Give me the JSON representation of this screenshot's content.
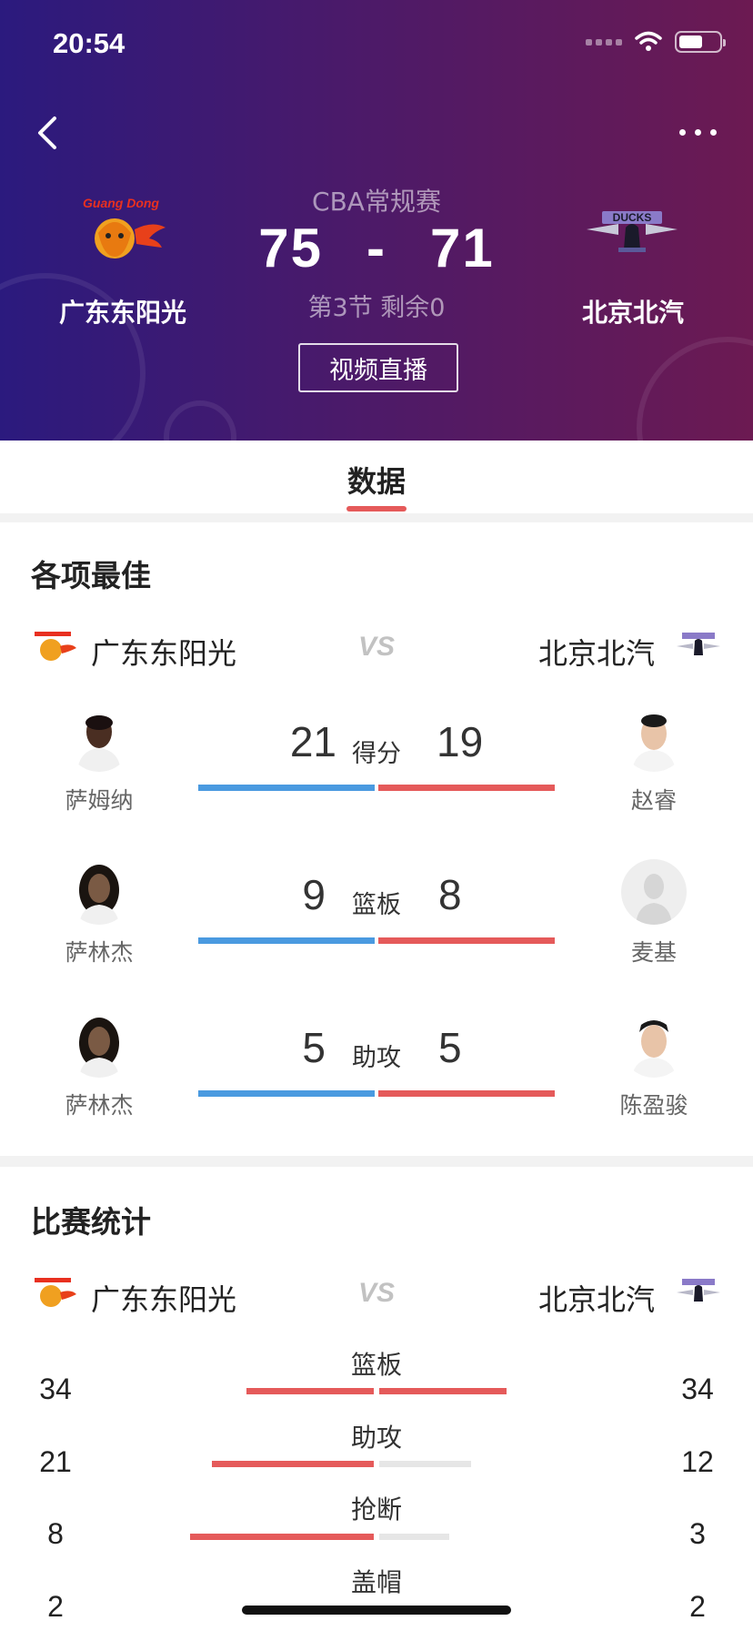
{
  "status_bar": {
    "time": "20:54"
  },
  "header": {
    "league": "CBA常规赛",
    "home_score": "75",
    "score_separator": "-",
    "away_score": "71",
    "period": "第3节 剩余0",
    "live_button": "视频直播",
    "home_team": "广东东阳光",
    "away_team": "北京北汽",
    "home_logo_text": "Guang Dong",
    "away_logo_text": "DUCKS"
  },
  "tabs": [
    {
      "label": "数据",
      "active": true
    }
  ],
  "best": {
    "title": "各项最佳",
    "home_team": "广东东阳光",
    "away_team": "北京北汽",
    "vs": "VS",
    "rows": [
      {
        "label": "得分",
        "home_player": "萨姆纳",
        "home_value": "21",
        "away_player": "赵睿",
        "away_value": "19"
      },
      {
        "label": "篮板",
        "home_player": "萨林杰",
        "home_value": "9",
        "away_player": "麦基",
        "away_value": "8"
      },
      {
        "label": "助攻",
        "home_player": "萨林杰",
        "home_value": "5",
        "away_player": "陈盈骏",
        "away_value": "5"
      }
    ]
  },
  "stats": {
    "title": "比赛统计",
    "home_team": "广东东阳光",
    "away_team": "北京北汽",
    "vs": "VS",
    "rows": [
      {
        "label": "篮板",
        "home": "34",
        "away": "34",
        "home_bar_fraction": 1.0,
        "away_bar_fraction": 1.0
      },
      {
        "label": "助攻",
        "home": "21",
        "away": "12",
        "home_bar_fraction": 1.0,
        "away_bar_fraction": 0.57
      },
      {
        "label": "抢断",
        "home": "8",
        "away": "3",
        "home_bar_fraction": 1.0,
        "away_bar_fraction": 0.38
      },
      {
        "label": "盖帽",
        "home": "2",
        "away": "2",
        "home_bar_fraction": 1.0,
        "away_bar_fraction": 1.0
      }
    ]
  },
  "colors": {
    "home_bar": "#4a9ae0",
    "away_bar": "#e55a5a",
    "stat_bar": "#e55a5a",
    "stat_bar_empty": "#e6e6e6"
  }
}
